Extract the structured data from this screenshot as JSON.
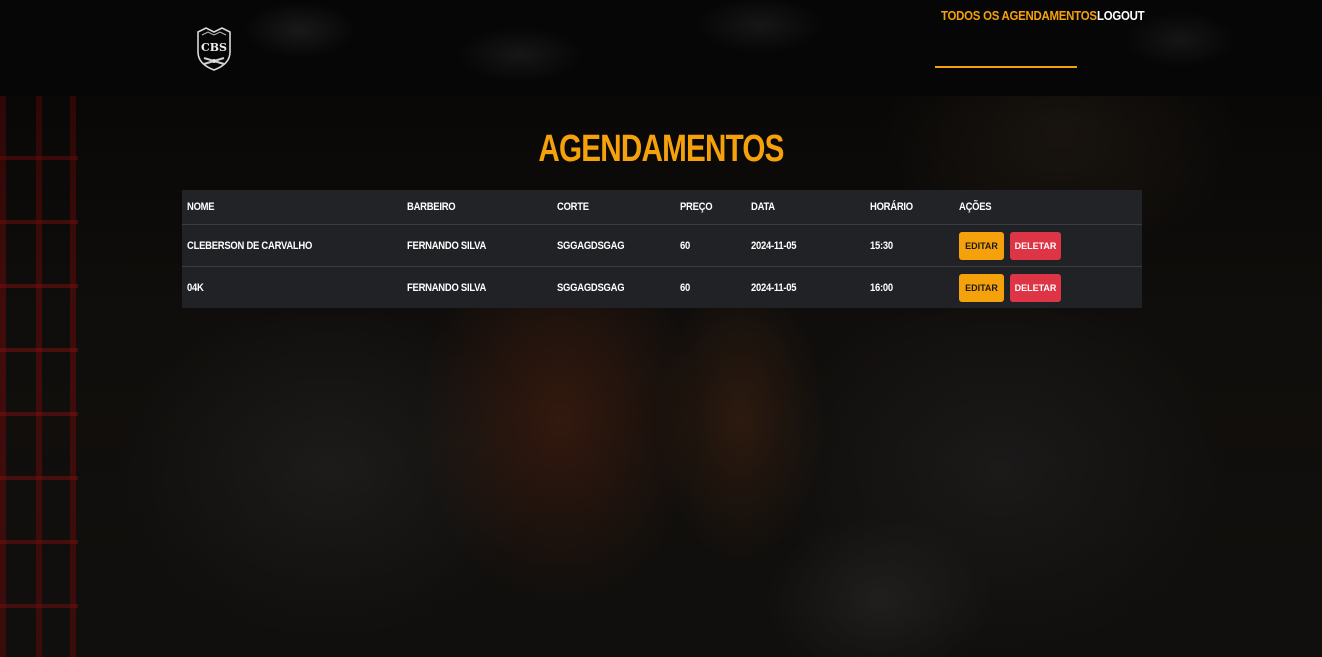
{
  "header": {
    "logo_text": "CBS",
    "nav": [
      {
        "label": "TODOS OS AGENDAMENTOS",
        "active": true
      },
      {
        "label": "LOGOUT",
        "active": false
      }
    ]
  },
  "main": {
    "title": "AGENDAMENTOS",
    "table": {
      "headers": [
        "NOME",
        "BARBEIRO",
        "CORTE",
        "PREÇO",
        "DATA",
        "HORÁRIO",
        "AÇÕES"
      ],
      "rows": [
        {
          "nome": "CLEBERSON DE CARVALHO",
          "barbeiro": "FERNANDO SILVA",
          "corte": "SGGAGDSGAG",
          "preco": "60",
          "data": "2024-11-05",
          "horario": "15:30"
        },
        {
          "nome": "04K",
          "barbeiro": "FERNANDO SILVA",
          "corte": "SGGAGDSGAG",
          "preco": "60",
          "data": "2024-11-05",
          "horario": "16:00"
        }
      ],
      "actions": {
        "edit_label": "EDITAR",
        "delete_label": "DELETAR"
      }
    }
  },
  "colors": {
    "accent": "#f5a10c",
    "danger": "#dd3545",
    "table_bg": "#222326",
    "header_bg": "#060606"
  }
}
